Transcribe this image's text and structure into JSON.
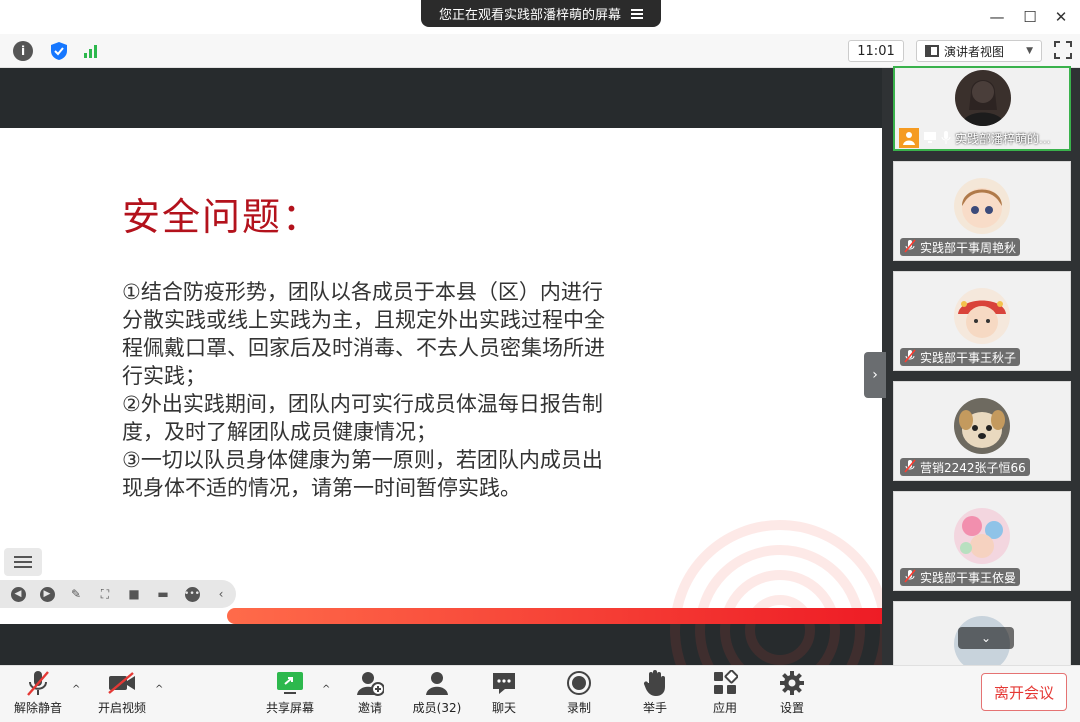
{
  "window": {
    "share_banner": "您正在观看实践部潘梓萌的屏幕",
    "minimize": "—",
    "maximize": "☐",
    "close": "✕"
  },
  "infobar": {
    "time": "11:01",
    "view_mode": "演讲者视图",
    "view_caret": "▼",
    "info_glyph": "i"
  },
  "slide": {
    "title": "安全问题：",
    "paragraphs": [
      "①结合防疫形势，团队以各成员于本县（区）内进行\n分散实践或线上实践为主，且规定外出实践过程中全\n程佩戴口罩、回家后及时消毒、不去人员密集场所进\n行实践；",
      "②外出实践期间，团队内可实行成员体温每日报告制\n度，及时了解团队成员健康情况；",
      "③一切以队员身体健康为第一原则，若团队内成员出\n现身体不适的情况，请第一时间暂停实践。"
    ]
  },
  "participants": [
    {
      "name": "实践部潘梓萌的...",
      "active": true
    },
    {
      "name": "实践部干事周艳秋",
      "active": false
    },
    {
      "name": "实践部干事王秋子",
      "active": false
    },
    {
      "name": "营销2242张子恒66",
      "active": false
    },
    {
      "name": "实践部干事王依曼",
      "active": false
    }
  ],
  "panel": {
    "toggle_glyph": "›",
    "scroll_down_glyph": "⌄"
  },
  "toolbar": {
    "unmute": "解除静音",
    "start_video": "开启视频",
    "share_screen": "共享屏幕",
    "invite": "邀请",
    "members": "成员(32)",
    "chat": "聊天",
    "record": "录制",
    "raise_hand": "举手",
    "apps": "应用",
    "settings": "设置",
    "leave": "离开会议",
    "caret": "^"
  },
  "colors": {
    "slide_title": "#b3121c",
    "accent_red": "#ee1c25",
    "active_border": "#3ab24c",
    "leave_text": "#e53935"
  }
}
